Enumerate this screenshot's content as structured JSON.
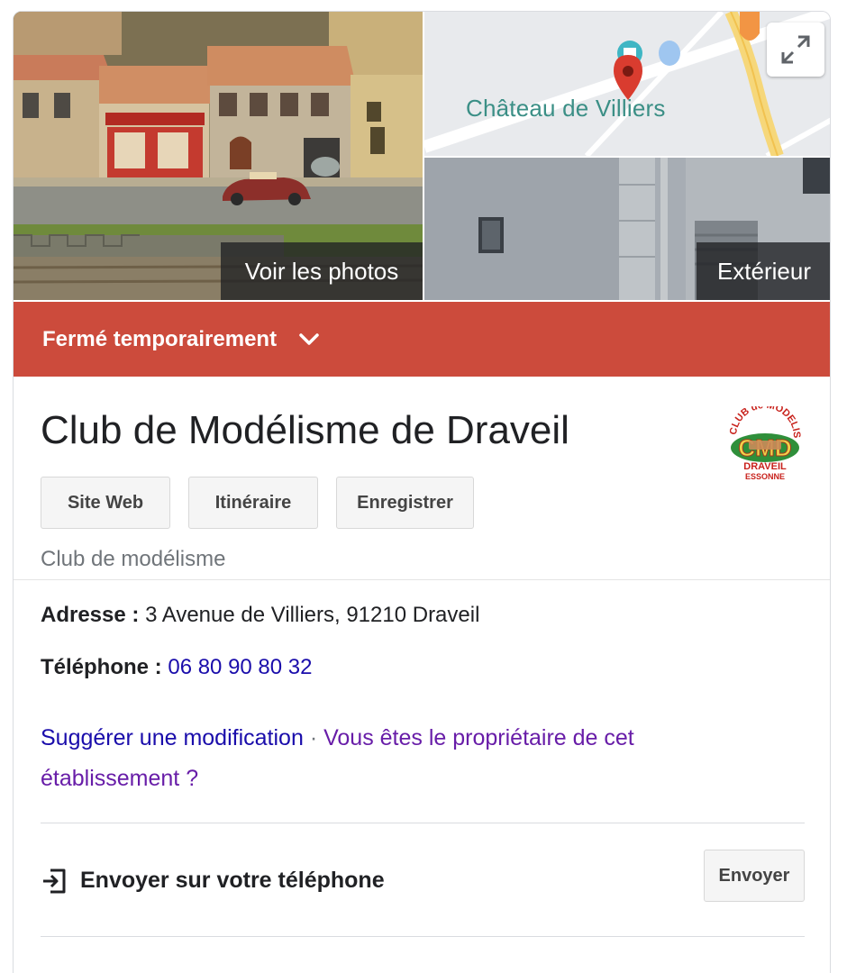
{
  "photos": {
    "main_overlay": "Voir les photos",
    "exterior_overlay": "Extérieur",
    "map_label": "Château de Villiers",
    "expand_icon": "expand-icon"
  },
  "status": {
    "text": "Fermé temporairement",
    "icon": "chevron-down-icon",
    "color": "#cc4b3c"
  },
  "place": {
    "name": "Club de Modélisme de Draveil",
    "category": "Club de modélisme",
    "logo": {
      "arc_text": "CLUB de MODELISME",
      "initials": "CMD",
      "bottom_text": "DRAVEIL",
      "bottom_text_2": "ESSONNE"
    }
  },
  "actions": [
    {
      "label": "Site Web"
    },
    {
      "label": "Itinéraire"
    },
    {
      "label": "Enregistrer"
    }
  ],
  "details": {
    "address_label": "Adresse :",
    "address_value": "3 Avenue de Villiers, 91210 Draveil",
    "phone_label": "Téléphone :",
    "phone_value": "06 80 90 80 32"
  },
  "links": {
    "suggest_edit": "Suggérer une modification",
    "separator": "·",
    "owner": "Vous êtes le propriétaire de cet établissement ?"
  },
  "send": {
    "label": "Envoyer sur votre téléphone",
    "button": "Envoyer",
    "icon": "send-to-phone-icon"
  },
  "colors": {
    "link_blue": "#1a0dab",
    "link_purple": "#681da8",
    "map_text": "#3b8f86"
  }
}
